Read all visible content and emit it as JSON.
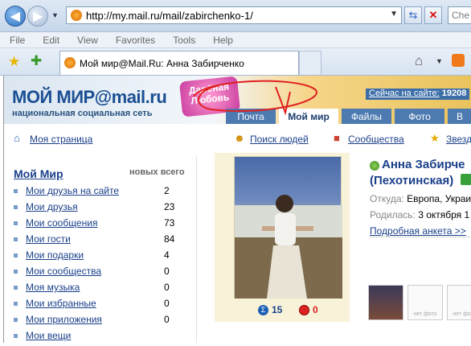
{
  "browser": {
    "url": "http://my.mail.ru/mail/zabirchenko-1/",
    "search_placeholder": "Che",
    "menu": [
      "File",
      "Edit",
      "View",
      "Favorites",
      "Tools",
      "Help"
    ],
    "tab_title": "Мой мир@Mail.Ru: Анна Забирченко"
  },
  "header": {
    "logo": "МОЙ МИР@mail.ru",
    "logo_sub": "национальная социальная сеть",
    "promo": "Дарёная Любовь",
    "online_label": "Сейчас на сайте:",
    "online_count": "19208",
    "nav_tabs": [
      "Почта",
      "Мой мир",
      "Файлы",
      "Фото",
      "В"
    ],
    "active_tab": "Мой мир"
  },
  "subnav": {
    "my_page": "Моя страница",
    "find_people": "Поиск людей",
    "communities": "Сообщества",
    "stars": "Звезд"
  },
  "sidebar": {
    "title": "Мой Мир",
    "col_new": "новых",
    "col_total": "всего",
    "items": [
      {
        "label": "Мои друзья на сайте",
        "count": "2"
      },
      {
        "label": "Мои друзья",
        "count": "23"
      },
      {
        "label": "Мои сообщения",
        "count": "73"
      },
      {
        "label": "Мои гости",
        "count": "84"
      },
      {
        "label": "Мои подарки",
        "count": "4"
      },
      {
        "label": "Мои сообщества",
        "count": "0"
      },
      {
        "label": "Моя музыка",
        "count": "0"
      },
      {
        "label": "Мои избранные",
        "count": "0"
      },
      {
        "label": "Мои приложения",
        "count": "0"
      },
      {
        "label": "Мои вещи",
        "count": ""
      }
    ]
  },
  "profile": {
    "name_line1": "Анна Забирче",
    "name_line2": "(Пехотинская)",
    "from_label": "Откуда:",
    "from_value": "Европа, Украи",
    "born_label": "Родилась:",
    "born_value": "3 октября 1",
    "more_link": "Подробная анкета >>",
    "photo_votes": "15",
    "photo_marks": "0",
    "no_photo": "нет фото"
  }
}
